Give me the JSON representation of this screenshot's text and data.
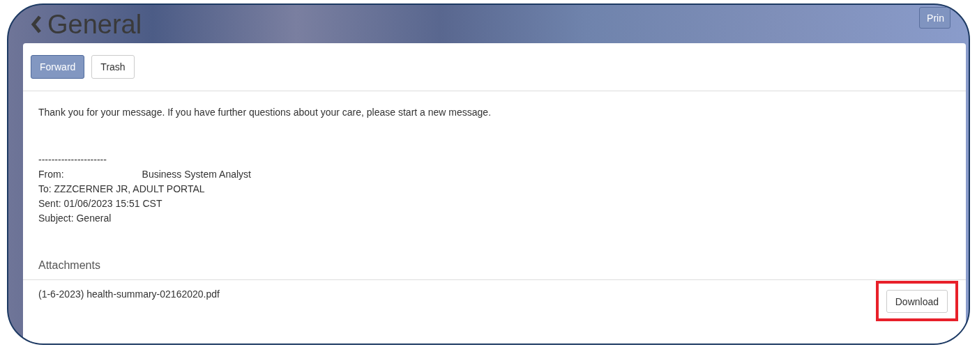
{
  "header": {
    "title": "General",
    "print_button": "Prin"
  },
  "toolbar": [
    {
      "label": "Forward",
      "primary": true
    },
    {
      "label": "Trash",
      "primary": false
    }
  ],
  "message": {
    "body": "Thank you for your message. If you have further questions about your care, please start a new message.",
    "separator": "---------------------",
    "from_label": "From:",
    "from_value": "Business System Analyst",
    "to": "To: ZZZCERNER JR, ADULT PORTAL",
    "sent": "Sent: 01/06/2023 15:51 CST",
    "subject": "Subject: General"
  },
  "attachments": {
    "heading": "Attachments",
    "items": [
      {
        "name": "(1-6-2023) health-summary-02162020.pdf",
        "button": "Download",
        "highlighted": true
      }
    ]
  }
}
